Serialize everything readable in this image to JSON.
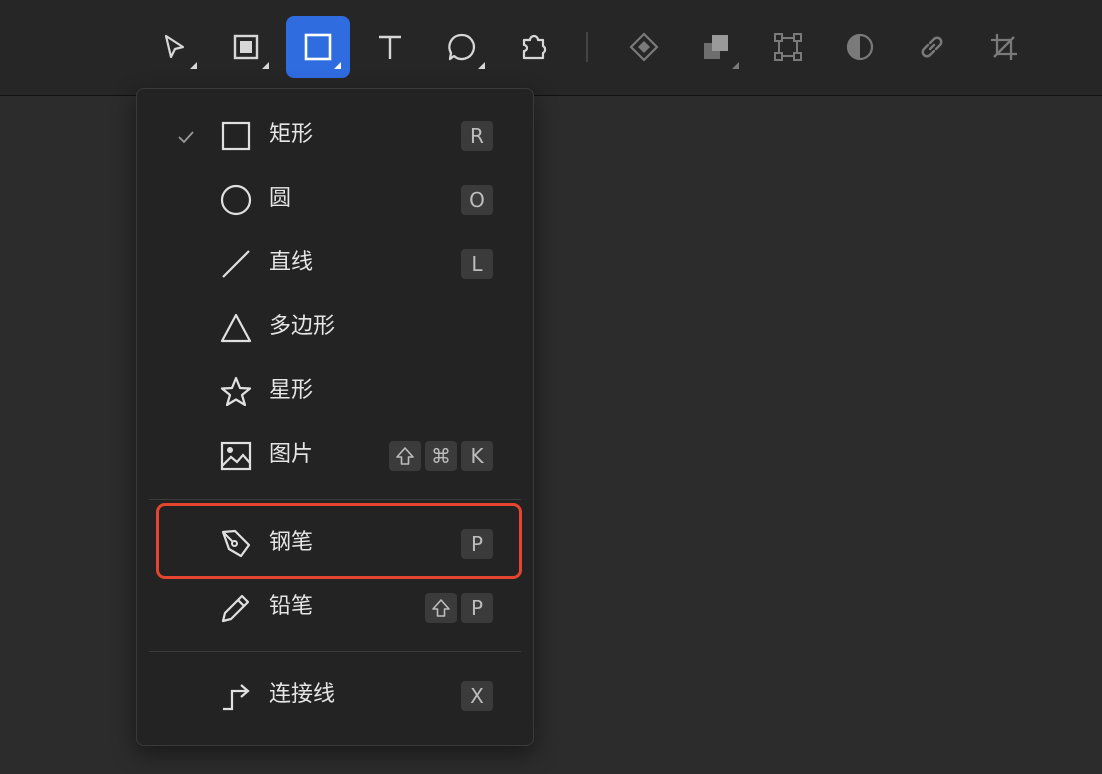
{
  "toolbar": {
    "tools": [
      {
        "name": "move-tool",
        "icon": "cursor-arrow-icon"
      },
      {
        "name": "frame-tool",
        "icon": "frame-square-icon"
      },
      {
        "name": "shape-tool",
        "icon": "rectangle-icon",
        "active": true
      },
      {
        "name": "text-tool",
        "icon": "text-T-icon"
      },
      {
        "name": "comment-tool",
        "icon": "speech-bubble-icon"
      },
      {
        "name": "plugin-tool",
        "icon": "puzzle-piece-icon"
      },
      {
        "name": "component-tool",
        "icon": "diamond-icon"
      },
      {
        "name": "boolean-tool",
        "icon": "boolean-squares-icon"
      },
      {
        "name": "vector-edit-tool",
        "icon": "vector-points-icon"
      },
      {
        "name": "mask-tool",
        "icon": "half-circle-icon"
      },
      {
        "name": "link-tool",
        "icon": "link-icon"
      },
      {
        "name": "crop-tool",
        "icon": "crop-icon"
      }
    ]
  },
  "menu": {
    "items": [
      {
        "label": "矩形",
        "icon": "rectangle-icon",
        "checked": true,
        "keys": [
          "R"
        ]
      },
      {
        "label": "圆",
        "icon": "circle-icon",
        "keys": [
          "O"
        ]
      },
      {
        "label": "直线",
        "icon": "line-icon",
        "keys": [
          "L"
        ]
      },
      {
        "label": "多边形",
        "icon": "triangle-icon",
        "keys": []
      },
      {
        "label": "星形",
        "icon": "star-icon",
        "keys": []
      },
      {
        "label": "图片",
        "icon": "image-icon",
        "keys": [
          "⇧",
          "⌘",
          "K"
        ]
      },
      {
        "label": "钢笔",
        "icon": "pen-icon",
        "keys": [
          "P"
        ]
      },
      {
        "label": "铅笔",
        "icon": "pencil-icon",
        "keys": [
          "⇧",
          "P"
        ]
      },
      {
        "label": "连接线",
        "icon": "connector-icon",
        "keys": [
          "X"
        ]
      }
    ]
  },
  "colors": {
    "accent": "#2f6ce0",
    "highlight_border": "#e5452f",
    "menu_bg": "#232323",
    "canvas_bg": "#2c2c2c"
  }
}
